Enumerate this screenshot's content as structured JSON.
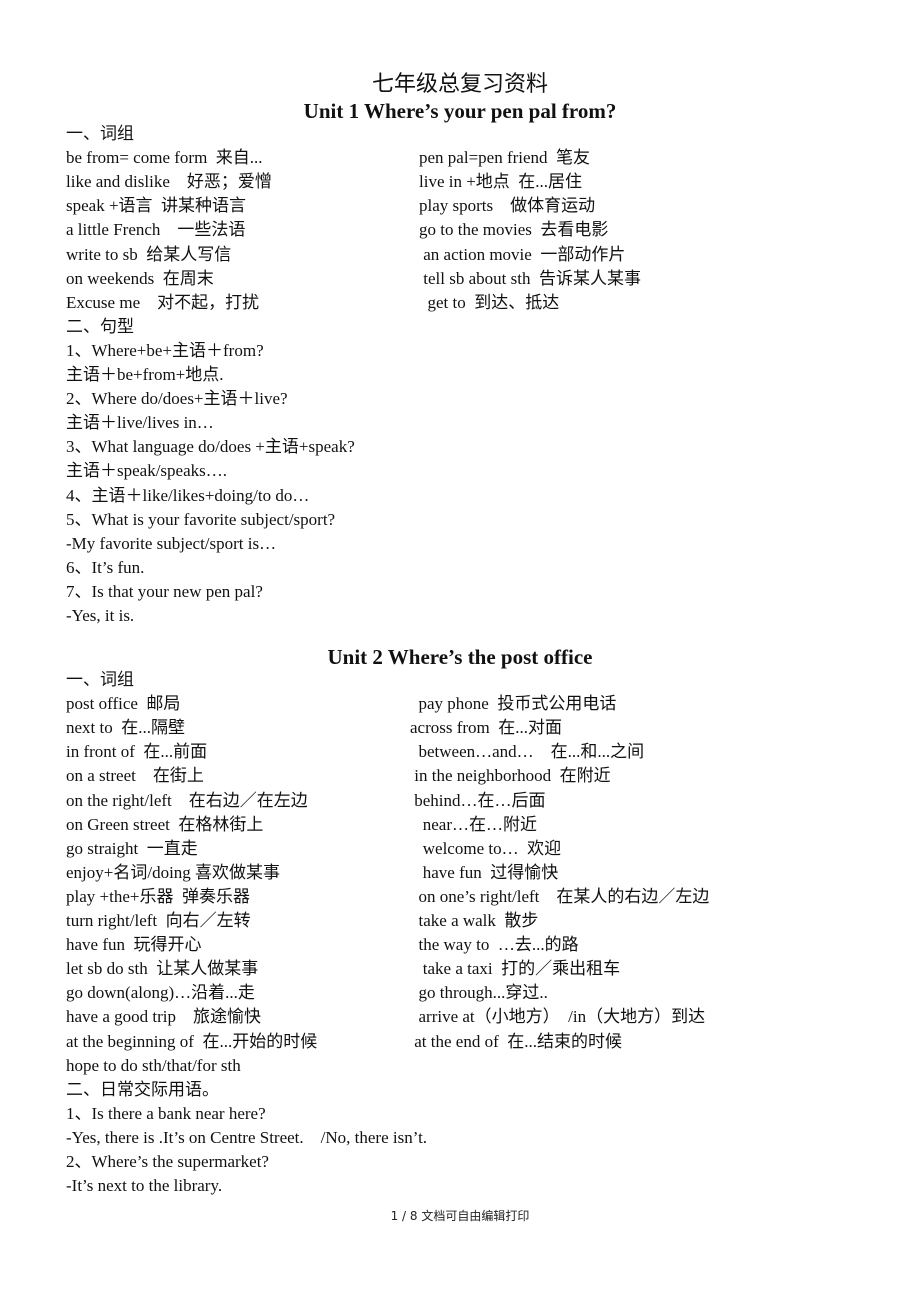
{
  "document": {
    "title": "七年级总复习资料",
    "units": [
      {
        "title": "Unit 1 Where’s your pen pal from?",
        "sections": [
          {
            "heading": "一、词组",
            "phrases_left": [
              "be from= come form  来自...",
              "like and dislike    好恶；爱憎",
              "speak +语言  讲某种语言",
              "a little French    一些法语",
              "write to sb  给某人写信",
              "on weekends  在周末",
              "Excuse me    对不起，打扰"
            ],
            "phrases_right": [
              "pen pal=pen friend  笔友",
              "live in +地点  在...居住",
              "play sports    做体育运动",
              "go to the movies  去看电影",
              " an action movie  一部动作片",
              " tell sb about sth  告诉某人某事",
              "  get to  到达、抵达"
            ]
          },
          {
            "heading": "二、句型",
            "lines": [
              "1、Where+be+主语＋from?",
              "主语＋be+from+地点.",
              "2、Where do/does+主语＋live?",
              "主语＋live/lives in…",
              "3、What language do/does +主语+speak?",
              "主语＋speak/speaks….",
              "4、主语＋like/likes+doing/to do…",
              "5、What is your favorite subject/sport?",
              "-My favorite subject/sport is…",
              "6、It’s fun.",
              "7、Is that your new pen pal?",
              "-Yes, it is."
            ]
          }
        ]
      },
      {
        "title": "Unit 2 Where’s the post office",
        "sections": [
          {
            "heading": "一、词组",
            "phrases_left": [
              "post office  邮局",
              "next to  在...隔壁",
              "in front of  在...前面",
              "on a street    在街上",
              "on the right/left    在右边／在左边",
              "on Green street  在格林街上",
              "go straight  一直走",
              "enjoy+名词/doing 喜欢做某事",
              "play +the+乐器  弹奏乐器",
              "turn right/left  向右／左转",
              "have fun  玩得开心",
              "let sb do sth  让某人做某事",
              "go down(along)…沿着...走",
              "have a good trip    旅途愉快",
              "at the beginning of  在...开始的时候",
              "hope to do sth/that/for sth"
            ],
            "phrases_right": [
              "  pay phone  投币式公用电话",
              "across from  在...对面",
              "  between…and…    在...和...之间",
              " in the neighborhood  在附近",
              " behind…在…后面",
              "   near…在…附近",
              "   welcome to…  欢迎",
              "   have fun  过得愉快",
              "  on one’s right/left    在某人的右边／左边",
              "  take a walk  散步",
              "  the way to  …去...的路",
              "   take a taxi  打的／乘出租车",
              "  go through...穿过..",
              "  arrive at（小地方）  /in（大地方）到达",
              " at the end of  在...结束的时候",
              ""
            ]
          },
          {
            "heading": "二、日常交际用语。",
            "lines": [
              "1、Is there a bank near here?",
              "-Yes, there is .It’s on Centre Street.    /No, there isn’t.",
              "2、Where’s the supermarket?",
              "-It’s next to the library."
            ]
          }
        ]
      }
    ],
    "footer": "1 / 8 文档可自由编辑打印"
  }
}
